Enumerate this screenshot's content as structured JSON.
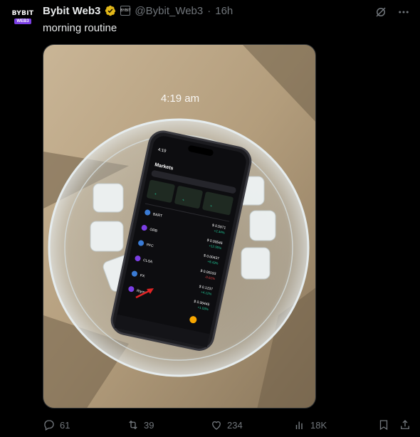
{
  "avatar": {
    "brand": "BYBIT",
    "brand_dot": "•",
    "sub": "WEB3"
  },
  "tweet": {
    "name": "Bybit Web3",
    "affiliate_badge": "BYBIT",
    "handle": "@Bybit_Web3",
    "separator": "·",
    "time": "16h",
    "text": "morning routine"
  },
  "media": {
    "time_overlay": "4:19 am",
    "phone": {
      "status_time": "4:19",
      "app_title": "Markets",
      "rows": [
        {
          "symbol": "BART",
          "price": "$ 0.5971",
          "change": "+2.34%"
        },
        {
          "symbol": "ORB",
          "price": "$ 0.00546",
          "change": "+12.95%"
        },
        {
          "symbol": "PFC",
          "price": "$ 0.00437",
          "change": "+8.43%"
        },
        {
          "symbol": "CLSA",
          "price": "$ 0.00193",
          "change": "-0.61%"
        },
        {
          "symbol": "PX",
          "price": "$ 0.1237",
          "change": "+4.12%"
        },
        {
          "symbol": "Riyme",
          "price": "$ 0.00445",
          "change": "+1.03%"
        }
      ]
    }
  },
  "actions": {
    "replies": "61",
    "reposts": "39",
    "likes": "234",
    "views": "18K"
  },
  "colors": {
    "verified": "#e2b719",
    "muted": "#71767b",
    "background": "#000000",
    "phone_accent": "#7b3fe4"
  }
}
